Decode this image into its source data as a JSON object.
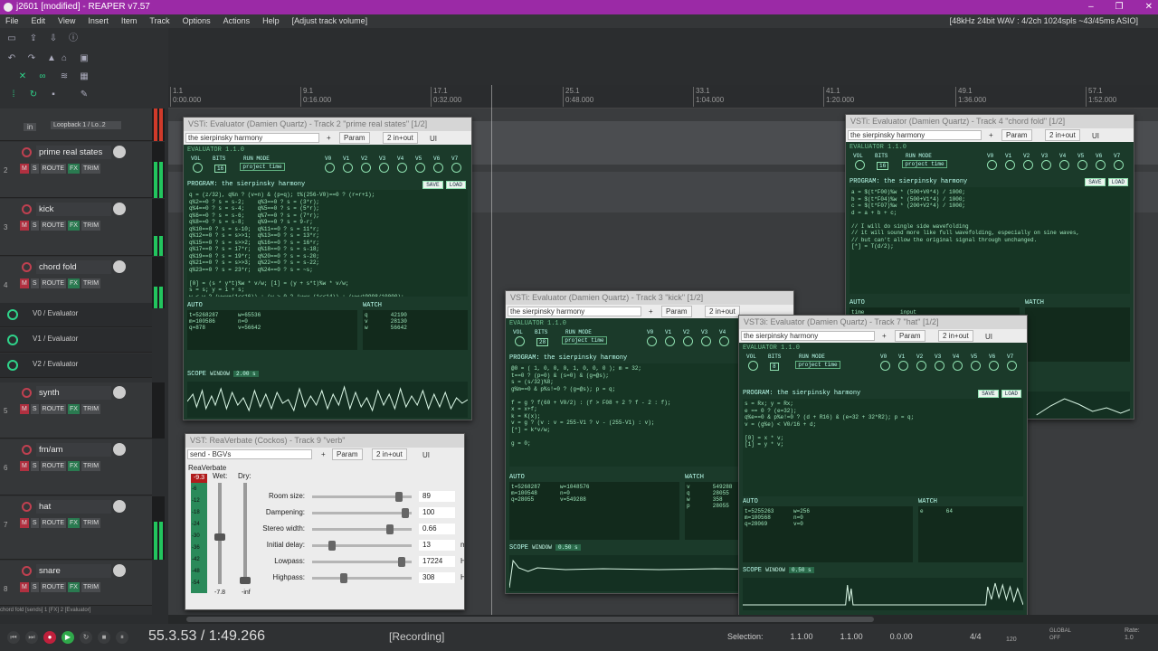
{
  "window": {
    "title": "j2601 [modified] - REAPER v7.57",
    "controls": [
      "–",
      "❐",
      "✕"
    ]
  },
  "menu": {
    "items": [
      "File",
      "Edit",
      "View",
      "Insert",
      "Item",
      "Track",
      "Options",
      "Actions",
      "Help",
      "[Adjust track volume]"
    ],
    "status": "[48kHz 24bit WAV : 4/2ch 1024spls ~43/45ms ASIO]"
  },
  "ruler": {
    "marks": [
      {
        "bar": "1.1",
        "time": "0:00.000"
      },
      {
        "bar": "9.1",
        "time": "0:16.000"
      },
      {
        "bar": "17.1",
        "time": "0:32.000"
      },
      {
        "bar": "25.1",
        "time": "0:48.000"
      },
      {
        "bar": "33.1",
        "time": "1:04.000"
      },
      {
        "bar": "41.1",
        "time": "1:20.000"
      },
      {
        "bar": "49.1",
        "time": "1:36.000"
      },
      {
        "bar": "57.1",
        "time": "1:52.000"
      }
    ]
  },
  "tracks": {
    "top": {
      "in": "in",
      "input": "Loopback 1 / Lo..2"
    },
    "t1": {
      "name": "prime real states",
      "num": "2"
    },
    "t2": {
      "name": "kick",
      "num": "3"
    },
    "t3": {
      "name": "chord fold",
      "num": "4"
    },
    "env": [
      "V0 / Evaluator",
      "V1 / Evaluator",
      "V2 / Evaluator"
    ],
    "t4": {
      "name": "synth",
      "num": "5"
    },
    "t5": {
      "name": "fm/am",
      "num": "6"
    },
    "t6": {
      "name": "hat",
      "num": "7"
    },
    "t7": {
      "name": "snare",
      "num": "8"
    },
    "buttons": {
      "m": "M",
      "s": "S",
      "route": "ROUTE",
      "fx": "FX",
      "trim": "TRIM"
    },
    "footer": "chord fold [sends] 1 [FX] 2 [Evaluator]"
  },
  "plugins": {
    "common": {
      "preset": "the sierpinsky harmony",
      "param": "Param",
      "io": "2 in+out",
      "ui": "UI",
      "plus": "+",
      "header": "EVALUATOR 1.1.0",
      "vol": "VOL",
      "bits": "BITS",
      "runmode": "RUN MODE",
      "run_value": "project time",
      "program": "PROGRAM:",
      "prog_name": "the sierpinsky harmony",
      "save": "SAVE",
      "load": "LOAD",
      "auto": "AUTO",
      "watch": "WATCH",
      "scope": "SCOPE",
      "window": "WINDOW",
      "knobs": [
        "V0",
        "V1",
        "V2",
        "V3",
        "V4",
        "V5",
        "V6",
        "V7"
      ],
      "time_col": "time",
      "input_col": "input"
    },
    "ev2": {
      "title": "VSTi: Evaluator (Damien Quartz) - Track 2 \"prime real states\" [1/2]",
      "bits": "16",
      "window": "2.00 s",
      "code": "q = (z/32), q%n ? (v=n) & (p=q); t%(256-V0)==0 ? (r=r+1);\nq%2==0 ? s = s-2;    q%3==0 ? s = (3*r);\nq%4==0 ? s = s-4;    q%5==0 ? s = (5*r);\nq%6==0 ? s = s-6;    q%7==0 ? s = (7*r);\nq%8==0 ? s = s-8;    q%9==0 ? s = 9-r;\nq%10==0 ? s = s-10;  q%11==0 ? s = 11*r;\nq%12==0 ? s = s>>1;  q%13==0 ? s = 13*r;\nq%15==0 ? s = s>>2;  q%16==0 ? s = 16*r;\nq%17==0 ? s = 17*r;  q%18==0 ? s = s-18;\nq%19==0 ? s = 19*r;  q%20==0 ? s = s-20;\nq%21==0 ? s = s>>3;  q%22==0 ? s = s-22;\nq%23==0 ? s = 23*r;  q%24==0 ? s = ~s;\n\n[0] = (s * y*t)%w * v/w; [1] = (y + s*t)%w * v/w;\ns = s; y = i + s;\nw < w ? (w=w+(1<<16)) : (w > 0 ? (w=w-(1<<14)) : (w=w*9998/10000);",
      "auto": "t=5268287      w=65536\nm=100586       n=0\nq=878          v=56642",
      "watch": "q       42190\nv       28130\nw       56642"
    },
    "ev4": {
      "title": "VSTi: Evaluator (Damien Quartz) - Track 4 \"chord fold\" [1/2]",
      "bits": "16",
      "code": "a = $(t*F00)%w * (500+V0*4) / 1000;\nb = $(t*F04)%w * (500+V1*4) / 1000;\nc = $(t*F07)%w * (200+V2*4) / 1000;\nd = a + b + c;\n\n// I will do single side wavefolding\n// it will sound more like full wavefolding, especially on sine waves,\n// but can't allow the original signal through unchanged.\n[*] = T(d/2);",
      "auto": "time           input",
      "watch": ""
    },
    "ev3": {
      "title": "VSTi: Evaluator (Damien Quartz) - Track 3 \"kick\" [1/2]",
      "bits": "28",
      "window": "0.50 s",
      "code": "@0 = ( 1, 0, 0, 0, 1, 0, 0, 0 ); m = 32;\nt==0 ? (p=0) & (s=0) & (g=@s);\ns = (s/32)%8;\ng%m==0 & p%s!=0 ? (g=@s); p = q;\n\nf = g ? f(60 + V0/2) : (f > F08 + 2 ? f - 2 : f);\nx = x+f;\nk = K(x);\nv = g ? (v : v = 255-V1 ? v - (255-V1) : v);\n[*] = k*v/w;\n\ng = 0;",
      "auto": "t=5268287      w=1048576\nm=100548       n=0\nq=28055        v=549288",
      "watch": "v       549288\nq       28055\nw       358\np       28055"
    },
    "ev7": {
      "title": "VST3i: Evaluator (Damien Quartz) - Track 7 \"hat\" [1/2]",
      "bits": "8",
      "window": "0.50 s",
      "code": "s = Rx; y = Rx;\ne == 0 ? (e=32);\nq%e==0 & p%e!=0 ? (d + R16) & (e=32 + 32*R2); p = q;\nv = (g%e) < V0/16 + d;\n\n[0] = x * v;\n[1] = y * v;",
      "auto": "t=5255263      w=256\nm=100568       n=0\nq=28069        v=0",
      "watch": "e       64"
    }
  },
  "verb": {
    "title": "VST: ReaVerbate (Cockos) - Track 9 \"verb\"",
    "preset": "send - BGVs",
    "param": "Param",
    "io": "2 in+out",
    "ui": "UI",
    "plus": "+",
    "name": "ReaVerbate",
    "peak": "-9.3",
    "wet": "Wet:",
    "dry": "Dry:",
    "wet_val": "-7.8",
    "dry_val": "-inf",
    "scale": [
      "-6",
      "-12",
      "-18",
      "-24",
      "-30",
      "-36",
      "-42",
      "-48",
      "-54"
    ],
    "rows": [
      {
        "label": "Room size:",
        "value": "89",
        "unit": "",
        "level": 0.9
      },
      {
        "label": "Dampening:",
        "value": "100",
        "unit": "",
        "level": 0.97
      },
      {
        "label": "Stereo width:",
        "value": "0.66",
        "unit": "",
        "level": 0.8
      },
      {
        "label": "Initial delay:",
        "value": "13",
        "unit": "ms",
        "level": 0.18
      },
      {
        "label": "Lowpass:",
        "value": "17224",
        "unit": "Hz",
        "level": 0.93
      },
      {
        "label": "Highpass:",
        "value": "308",
        "unit": "Hz",
        "level": 0.3
      }
    ]
  },
  "transport": {
    "time": "55.3.53 / 1:49.266",
    "status": "[Recording]",
    "selection_label": "Selection:",
    "sel_start": "1.1.00",
    "sel_end": "1.1.00",
    "sel_len": "0.0.00",
    "timesig": "4/4",
    "bpm": "120",
    "global": "GLOBAL",
    "global_state": "OFF",
    "rate_label": "Rate:",
    "rate": "1.0"
  },
  "colors": {
    "title_bar": "#9b2aa6",
    "evaluator_bg": "#1b3a2a",
    "meter": "#22c55e",
    "record": "#c0203c"
  }
}
